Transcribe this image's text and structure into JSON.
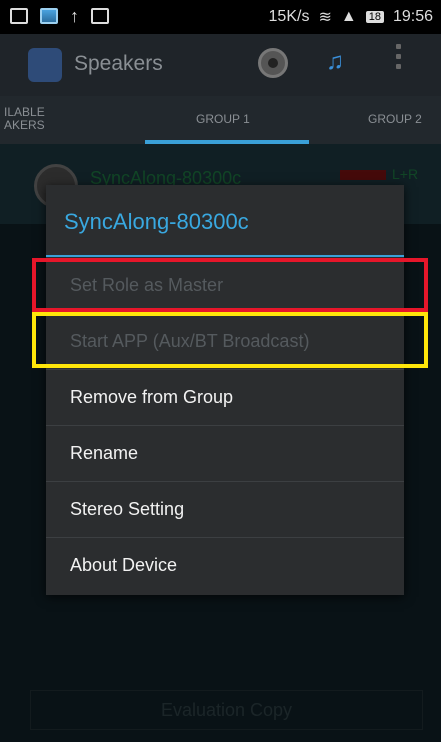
{
  "status_bar": {
    "speed": "15K/s",
    "battery": "18",
    "time": "19:56"
  },
  "action_bar": {
    "title": "Speakers",
    "icons": [
      "app-icon",
      "speaker-icon",
      "music-icon",
      "overflow-menu-icon"
    ]
  },
  "tabs": [
    {
      "label": "ILABLE AKERS"
    },
    {
      "label": "GROUP 1",
      "selected": true
    },
    {
      "label": "GROUP 2"
    }
  ],
  "background_item": {
    "name": "SyncAlong-80300c",
    "channel": "L+R"
  },
  "dialog": {
    "title": "SyncAlong-80300c",
    "items": [
      {
        "label": "Set Role as Master",
        "enabled": false
      },
      {
        "label": "Start APP (Aux/BT Broadcast)",
        "enabled": false
      },
      {
        "label": "Remove from Group",
        "enabled": true
      },
      {
        "label": "Rename",
        "enabled": true
      },
      {
        "label": "Stereo Setting",
        "enabled": true
      },
      {
        "label": "About Device",
        "enabled": true
      }
    ]
  },
  "footer": {
    "label": "Evaluation Copy"
  },
  "colors": {
    "accent": "#3aa0d8",
    "highlight_red": "#e6162a",
    "highlight_yellow": "#ffe60a"
  }
}
